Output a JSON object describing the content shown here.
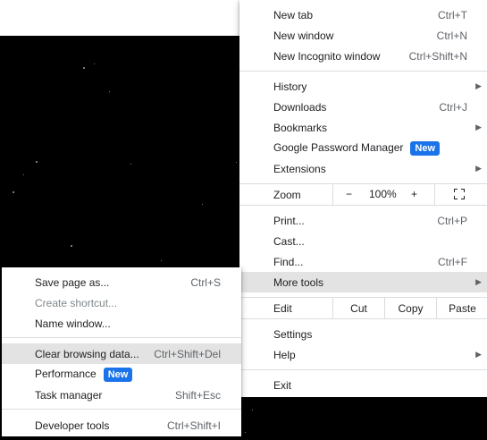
{
  "main_menu": {
    "new_tab": {
      "label": "New tab",
      "shortcut": "Ctrl+T"
    },
    "new_window": {
      "label": "New window",
      "shortcut": "Ctrl+N"
    },
    "new_incognito": {
      "label": "New Incognito window",
      "shortcut": "Ctrl+Shift+N"
    },
    "history": {
      "label": "History"
    },
    "downloads": {
      "label": "Downloads",
      "shortcut": "Ctrl+J"
    },
    "bookmarks": {
      "label": "Bookmarks"
    },
    "password_manager": {
      "label": "Google Password Manager",
      "badge": "New"
    },
    "extensions": {
      "label": "Extensions"
    },
    "zoom": {
      "label": "Zoom",
      "minus": "−",
      "level": "100%",
      "plus": "+"
    },
    "print": {
      "label": "Print...",
      "shortcut": "Ctrl+P"
    },
    "cast": {
      "label": "Cast..."
    },
    "find": {
      "label": "Find...",
      "shortcut": "Ctrl+F"
    },
    "more_tools": {
      "label": "More tools"
    },
    "edit": {
      "label": "Edit",
      "cut": "Cut",
      "copy": "Copy",
      "paste": "Paste"
    },
    "settings": {
      "label": "Settings"
    },
    "help": {
      "label": "Help"
    },
    "exit": {
      "label": "Exit"
    }
  },
  "more_tools_submenu": {
    "save_page": {
      "label": "Save page as...",
      "shortcut": "Ctrl+S"
    },
    "create_shortcut": {
      "label": "Create shortcut..."
    },
    "name_window": {
      "label": "Name window..."
    },
    "clear_browsing": {
      "label": "Clear browsing data...",
      "shortcut": "Ctrl+Shift+Del"
    },
    "performance": {
      "label": "Performance",
      "badge": "New"
    },
    "task_manager": {
      "label": "Task manager",
      "shortcut": "Shift+Esc"
    },
    "developer_tools": {
      "label": "Developer tools",
      "shortcut": "Ctrl+Shift+I"
    }
  },
  "icons": {
    "submenu_arrow": "arrow-right-icon",
    "fullscreen": "fullscreen-icon"
  },
  "colors": {
    "badge_bg": "#1a73e8",
    "highlight": "#e3e3e3",
    "separator": "#dadce0",
    "page_bg": "#000000"
  }
}
